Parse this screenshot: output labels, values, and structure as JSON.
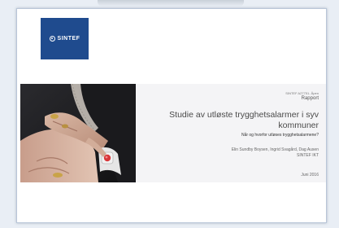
{
  "report": {
    "logo_text": "SINTEF",
    "classification": "SINTEF A27751- Åpen",
    "doc_type": "Rapport",
    "title": "Studie av utløste trygghetsalarmer i syv kommuner",
    "subtitle": "Når og hvorfor utløses trygghetsalarmene?",
    "authors": "Elin Sundby Boysen, Ingrid Svagård, Dag Ausen",
    "organization": "SINTEF IKT",
    "date": "Juni 2016"
  },
  "colors": {
    "brand": "#1f4b8e",
    "background": "#e9eef5",
    "title_band": "#f4f4f6"
  },
  "photo": {
    "description_icon": "photo-wrist-alarm-icon"
  }
}
